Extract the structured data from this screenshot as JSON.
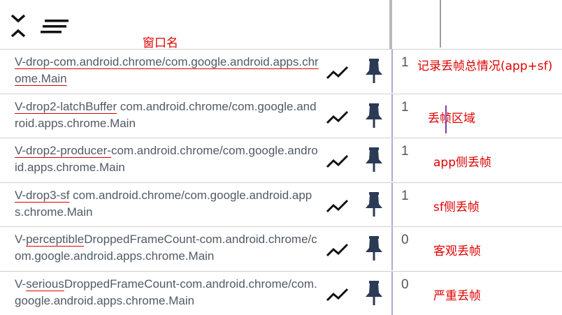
{
  "annotations": {
    "window_name": "窗口名"
  },
  "rows": [
    {
      "parts": [
        {
          "text": "V-drop",
          "underline": true
        },
        {
          "text": "-com.android.chrome/com.google.android.apps.",
          "underline": true
        },
        {
          "text": "chrome.Main",
          "underline": true
        }
      ],
      "count": "1",
      "note": "记录丢帧总情况(app+sf)"
    },
    {
      "parts": [
        {
          "text": "V-drop2-latchBuffer",
          "underline": true
        },
        {
          "text": " com.android.chrome/com.google.android.apps.chrome.Main",
          "underline": false
        }
      ],
      "count": "1",
      "note": "丢帧区域"
    },
    {
      "parts": [
        {
          "text": "V-drop2-producer-",
          "underline": true
        },
        {
          "text": "com.android.chrome/com.google.android.apps.chrome.Main",
          "underline": false
        }
      ],
      "count": "1",
      "note": "app侧丢帧"
    },
    {
      "parts": [
        {
          "text": "V-drop3-sf",
          "underline": true
        },
        {
          "text": " com.android.chrome/com.google.android.apps.chrome.Main",
          "underline": false
        }
      ],
      "count": "1",
      "note": "sf侧丢帧"
    },
    {
      "parts": [
        {
          "text": "V-",
          "underline": false
        },
        {
          "text": "perceptible",
          "underline": true
        },
        {
          "text": "DroppedFrameCount-com.android.chrome/com.google.android.apps.chrome.Main",
          "underline": false
        }
      ],
      "count": "0",
      "note": "客观丢帧"
    },
    {
      "parts": [
        {
          "text": "V-",
          "underline": false
        },
        {
          "text": "serious",
          "underline": true
        },
        {
          "text": "DroppedFrameCount-com.android.chrome/com.google.android.apps.chrome.Main",
          "underline": false
        }
      ],
      "count": "0",
      "note": "严重丢帧"
    }
  ],
  "icons": {
    "expand": "expand-collapse-icon",
    "sort": "sort-icon",
    "chart": "chart-icon",
    "pin": "pin-icon"
  },
  "colors": {
    "annotation": "#e00000",
    "icon": "#2b3a55",
    "text": "#505a64"
  }
}
